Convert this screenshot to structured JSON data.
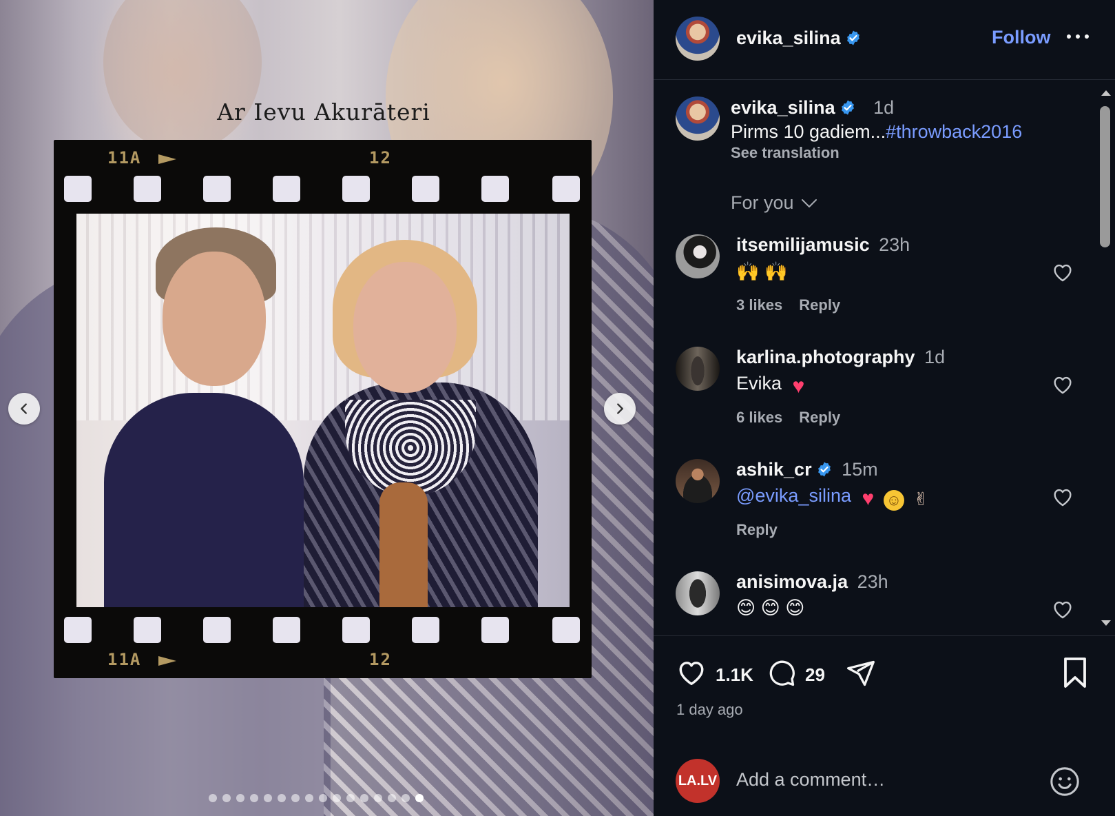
{
  "post": {
    "image_caption": "Ar Ievu Akurāteri",
    "film_codes": {
      "left": "11A",
      "right": "12"
    },
    "carousel": {
      "total": 16,
      "active_index": 15
    }
  },
  "header": {
    "username": "evika_silina",
    "verified": true,
    "follow_label": "Follow",
    "more_icon": "more-horizontal-icon"
  },
  "caption": {
    "username": "evika_silina",
    "time": "1d",
    "text": "Pirms 10 gadiem...",
    "hashtag": "#throwback2016",
    "see_translation": "See translation"
  },
  "sort": {
    "label": "For you"
  },
  "comments": [
    {
      "username": "itsemilijamusic",
      "verified": false,
      "time": "23h",
      "text": "🙌 🙌",
      "likes": "3 likes",
      "reply": "Reply"
    },
    {
      "username": "karlina.photography",
      "verified": false,
      "time": "1d",
      "text": "Evika",
      "likes": "6 likes",
      "reply": "Reply"
    },
    {
      "username": "ashik_cr",
      "verified": true,
      "time": "15m",
      "mention": "@evika_silina",
      "likes": "",
      "reply": "Reply"
    },
    {
      "username": "anisimova.ja",
      "verified": false,
      "time": "23h",
      "text": "😊 😊 😊",
      "likes": "",
      "reply": ""
    }
  ],
  "actions": {
    "like_count": "1.1K",
    "comment_count": "29",
    "posted": "1 day ago"
  },
  "composer": {
    "avatar_text": "LA.LV",
    "placeholder": "Add a comment…"
  },
  "colors": {
    "accent": "#7a9cff",
    "panel_bg": "#0c1018",
    "muted": "#a8acb3",
    "heart": "#ff3f6e",
    "lalv": "#c2322b"
  }
}
